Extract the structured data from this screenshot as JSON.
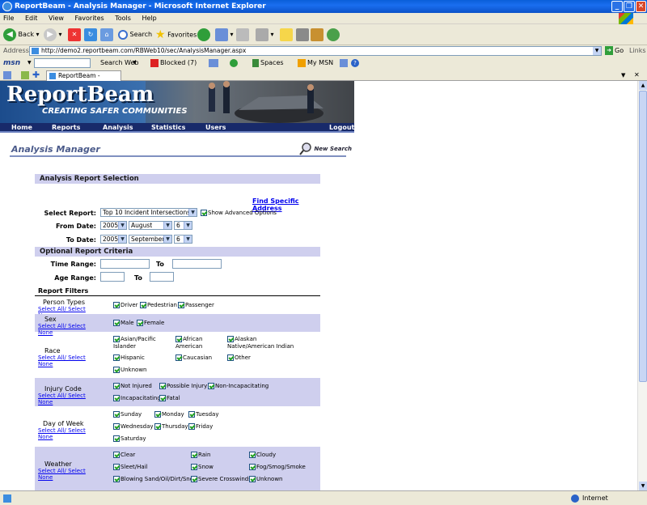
{
  "window": {
    "title": "ReportBeam - Analysis Manager - Microsoft Internet Explorer"
  },
  "menu": [
    "File",
    "Edit",
    "View",
    "Favorites",
    "Tools",
    "Help"
  ],
  "toolbar": {
    "back": "Back",
    "search": "Search",
    "favorites": "Favorites"
  },
  "address": {
    "label": "Address",
    "url": "http://demo2.reportbeam.com/RBWeb10/sec/AnalysisManager.aspx",
    "go": "Go",
    "links": "Links"
  },
  "msnbar": {
    "logo": "msn",
    "search_web": "Search Web",
    "blocked": "Blocked (7)",
    "spaces": "Spaces",
    "mymsn": "My MSN"
  },
  "tab": {
    "label": "ReportBeam - Analysi..."
  },
  "banner": {
    "logo": "ReportBeam",
    "tagline": "Creating Safer Communities"
  },
  "nav": [
    "Home",
    "Reports",
    "Analysis",
    "Statistics",
    "Users",
    "Logout"
  ],
  "page": {
    "title": "Analysis Manager",
    "new_search": "New Search"
  },
  "form": {
    "section_title": "Analysis Report Selection",
    "find_address": "Find Specific Address",
    "select_report_label": "Select Report:",
    "select_report_value": "Top 10 Incident Intersections",
    "advanced_label": "Show Advanced Options",
    "from_label": "From Date:",
    "from": {
      "year": "2005",
      "month": "August",
      "day": "6"
    },
    "to_label": "To Date:",
    "to": {
      "year": "2005",
      "month": "September",
      "day": "6"
    },
    "optional_title": "Optional Report Criteria",
    "time_range_label": "Time Range:",
    "age_range_label": "Age Range:",
    "to_word": "To",
    "filters_title": "Report Filters",
    "select_all": "Select All/",
    "select_none": "Select None"
  },
  "filters": [
    {
      "name": "Person Types",
      "options": [
        "Driver",
        "Pedestrian",
        "Passenger"
      ]
    },
    {
      "name": "Sex",
      "options": [
        "Male",
        "Female"
      ]
    },
    {
      "name": "Race",
      "options": [
        "Asian/Pacific Islander",
        "African American",
        "Alaskan Native/American Indian",
        "Hispanic",
        "Caucasian",
        "Other",
        "Unknown"
      ]
    },
    {
      "name": "Injury Code",
      "options": [
        "Not Injured",
        "Possible Injury",
        "Non-Incapacitating",
        "Incapacitating",
        "Fatal"
      ]
    },
    {
      "name": "Day of Week",
      "options": [
        "Sunday",
        "Monday",
        "Tuesday",
        "Wednesday",
        "Thursday",
        "Friday",
        "Saturday"
      ]
    },
    {
      "name": "Weather",
      "options": [
        "Clear",
        "Rain",
        "Cloudy",
        "Sleet/Hail",
        "Snow",
        "Fog/Smog/Smoke",
        "Blowing Sand/Oil/Dirt/Snow",
        "Severe Crosswinds",
        "Unknown"
      ]
    }
  ],
  "status": {
    "zone": "Internet"
  }
}
